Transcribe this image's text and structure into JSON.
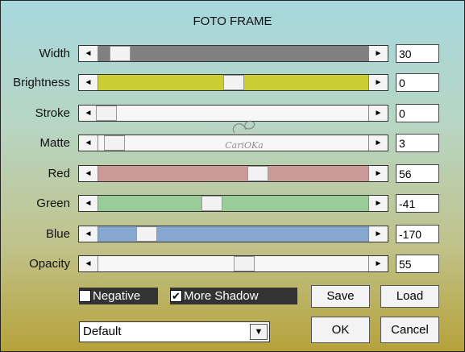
{
  "title": "FOTO FRAME",
  "watermark_text": "CariOKa",
  "sliders": [
    {
      "label": "Width",
      "value": "30",
      "color": "#808080",
      "fraction": 0.08
    },
    {
      "label": "Brightness",
      "value": "0",
      "color": "#cccc33",
      "fraction": 0.5
    },
    {
      "label": "Stroke",
      "value": "0",
      "color": "#f7f7f7",
      "fraction": 0.03
    },
    {
      "label": "Matte",
      "value": "3",
      "color": "#f7f7f7",
      "fraction": 0.06
    },
    {
      "label": "Red",
      "value": "56",
      "color": "#cc9999",
      "fraction": 0.59
    },
    {
      "label": "Green",
      "value": "-41",
      "color": "#99cc99",
      "fraction": 0.42
    },
    {
      "label": "Blue",
      "value": "-170",
      "color": "#85a7d0",
      "fraction": 0.18
    },
    {
      "label": "Opacity",
      "value": "55",
      "color": "#f7f7f7",
      "fraction": 0.54
    }
  ],
  "checkboxes": {
    "negative": {
      "label": "Negative",
      "checked": false
    },
    "more_shadow": {
      "label": "More Shadow",
      "checked": true
    }
  },
  "buttons": {
    "save": "Save",
    "load": "Load",
    "ok": "OK",
    "cancel": "Cancel"
  },
  "preset": {
    "selected": "Default"
  },
  "icons": {
    "left_arrow": "◄",
    "right_arrow": "►",
    "dropdown": "▼",
    "check": "✔"
  }
}
